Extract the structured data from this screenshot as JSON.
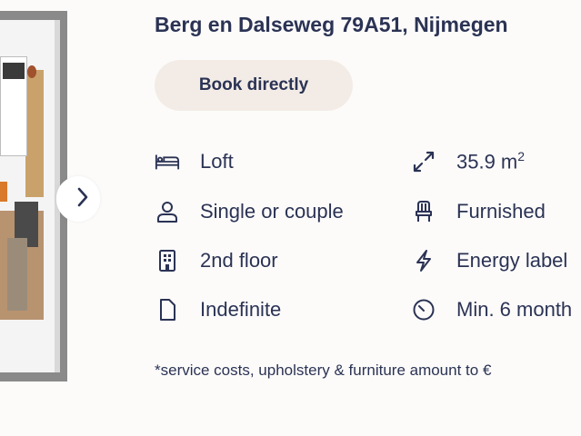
{
  "listing": {
    "title": "Berg en Dalseweg 79A51, Nijmegen",
    "book_label": "Book directly"
  },
  "features": [
    {
      "icon": "bed-icon",
      "label": "Loft"
    },
    {
      "icon": "expand-arrows-icon",
      "label": "35.9 m",
      "sup": "2"
    },
    {
      "icon": "person-icon",
      "label": "Single or couple"
    },
    {
      "icon": "chair-icon",
      "label": "Furnished"
    },
    {
      "icon": "building-icon",
      "label": "2nd floor"
    },
    {
      "icon": "lightning-icon",
      "label": "Energy label"
    },
    {
      "icon": "document-icon",
      "label": "Indefinite"
    },
    {
      "icon": "clock-icon",
      "label": "Min. 6 month"
    }
  ],
  "footnote": "*service costs, upholstery & furniture amount to €"
}
